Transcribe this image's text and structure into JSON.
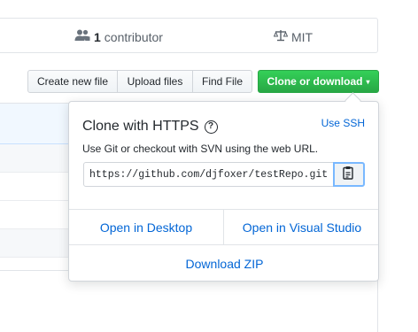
{
  "summary": {
    "contributors_count": "1",
    "contributors_label": "contributor",
    "license": "MIT"
  },
  "toolbar": {
    "create_new_file": "Create new file",
    "upload_files": "Upload files",
    "find_file": "Find File",
    "clone_or_download": "Clone or download",
    "clone_caret": "▾"
  },
  "clone_popover": {
    "title": "Clone with HTTPS",
    "help_glyph": "?",
    "use_ssh": "Use SSH",
    "description": "Use Git or checkout with SVN using the web URL.",
    "url_value": "https://github.com/djfoxer/testRepo.git",
    "open_in_desktop": "Open in Desktop",
    "open_in_visual_studio": "Open in Visual Studio",
    "download_zip": "Download ZIP"
  },
  "icons": {
    "contributors": "people-icon",
    "license": "law-scale-icon",
    "copy": "clipboard-icon",
    "help": "question-circle-icon"
  },
  "colors": {
    "accent_green": "#28a745",
    "link_blue": "#0366d6",
    "border": "#e1e4e8"
  }
}
